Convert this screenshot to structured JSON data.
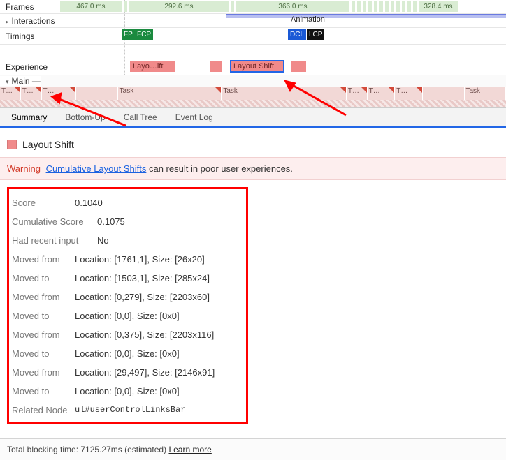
{
  "timeline": {
    "rows": {
      "frames": "Frames",
      "interactions": "Interactions",
      "timings": "Timings",
      "experience": "Experience",
      "main": "Main"
    },
    "frame_times": [
      "467.0 ms",
      "292.6 ms",
      "366.0 ms",
      "328.4 ms"
    ],
    "animation_label": "Animation",
    "timings_badges": [
      "FP",
      "FCP",
      "DCL",
      "LCP"
    ],
    "experience_blocks": [
      "Layo…ift",
      "Layout Shift"
    ],
    "task_labels": [
      "T…",
      "T…",
      "T…",
      "Task",
      "Task",
      "T…",
      "T…",
      "T…",
      "Task"
    ],
    "main_suffix": " —"
  },
  "tabs": [
    "Summary",
    "Bottom-Up",
    "Call Tree",
    "Event Log"
  ],
  "panel": {
    "title": "Layout Shift",
    "warning_label": "Warning",
    "warning_link": "Cumulative Layout Shifts",
    "warning_rest": " can result in poor user experiences.",
    "rows": [
      {
        "k": "Score",
        "v": "0.1040"
      },
      {
        "k": "Cumulative Score",
        "v": "0.1075"
      },
      {
        "k": "Had recent input",
        "v": "No"
      },
      {
        "k": "Moved from",
        "v": "Location: [1761,1], Size: [26x20]"
      },
      {
        "k": "Moved to",
        "v": "Location: [1503,1], Size: [285x24]"
      },
      {
        "k": "Moved from",
        "v": "Location: [0,279], Size: [2203x60]"
      },
      {
        "k": "Moved to",
        "v": "Location: [0,0], Size: [0x0]"
      },
      {
        "k": "Moved from",
        "v": "Location: [0,375], Size: [2203x116]"
      },
      {
        "k": "Moved to",
        "v": "Location: [0,0], Size: [0x0]"
      },
      {
        "k": "Moved from",
        "v": "Location: [29,497], Size: [2146x91]"
      },
      {
        "k": "Moved to",
        "v": "Location: [0,0], Size: [0x0]"
      }
    ],
    "related_node_label": "Related Node",
    "related_node_value": "ul#userControlLinksBar"
  },
  "footer": {
    "text": "Total blocking time: 7125.27ms (estimated) ",
    "learn_more": "Learn more"
  }
}
